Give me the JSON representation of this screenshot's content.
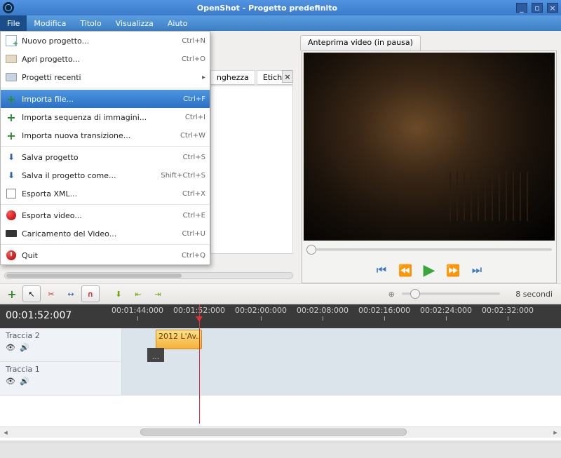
{
  "window": {
    "title": "OpenShot - Progetto predefinito"
  },
  "menubar": {
    "items": [
      "File",
      "Modifica",
      "Titolo",
      "Visualizza",
      "Aiuto"
    ],
    "active_index": 0
  },
  "file_menu": {
    "items": [
      {
        "icon": "new-file-icon",
        "label": "Nuovo progetto...",
        "shortcut": "Ctrl+N"
      },
      {
        "icon": "folder-open-icon",
        "label": "Apri progetto...",
        "shortcut": "Ctrl+O"
      },
      {
        "icon": "folder-icon",
        "label": "Progetti recenti",
        "shortcut": "",
        "submenu": true
      },
      {
        "sep": true
      },
      {
        "icon": "plus-icon",
        "label": "Importa file...",
        "shortcut": "Ctrl+F",
        "highlight": true
      },
      {
        "icon": "plus-icon",
        "label": "Importa sequenza di immagini...",
        "shortcut": "Ctrl+I"
      },
      {
        "icon": "plus-icon",
        "label": "Importa nuova transizione...",
        "shortcut": "Ctrl+W"
      },
      {
        "sep": true
      },
      {
        "icon": "save-icon",
        "label": "Salva progetto",
        "shortcut": "Ctrl+S"
      },
      {
        "icon": "saveas-icon",
        "label": "Salva il progetto come...",
        "shortcut": "Shift+Ctrl+S"
      },
      {
        "icon": "xml-icon",
        "label": "Esporta XML...",
        "shortcut": "Ctrl+X"
      },
      {
        "sep": true
      },
      {
        "icon": "red-dot-icon",
        "label": "Esporta video...",
        "shortcut": "Ctrl+E"
      },
      {
        "icon": "tape-icon",
        "label": "Caricamento del Video...",
        "shortcut": "Ctrl+U"
      },
      {
        "sep": true
      },
      {
        "icon": "power-icon",
        "label": "Quit",
        "shortcut": "Ctrl+Q"
      }
    ]
  },
  "project_files": {
    "columns": {
      "length": "nghezza",
      "label": "Etiche"
    }
  },
  "preview": {
    "tab_label": "Anteprima video (in pausa)"
  },
  "timeline": {
    "playhead_time": "00:01:52:007",
    "zoom_label": "8 secondi",
    "ruler_ticks": [
      "00:01:44:000",
      "00:01:52:000",
      "00:02:00:000",
      "00:02:08:000",
      "00:02:16:000",
      "00:02:24:000",
      "00:02:32:000"
    ],
    "tracks": [
      {
        "name": "Traccia 2",
        "clip_label": "2012 L'Av...",
        "transition_label": "..."
      },
      {
        "name": "Traccia 1"
      }
    ]
  }
}
